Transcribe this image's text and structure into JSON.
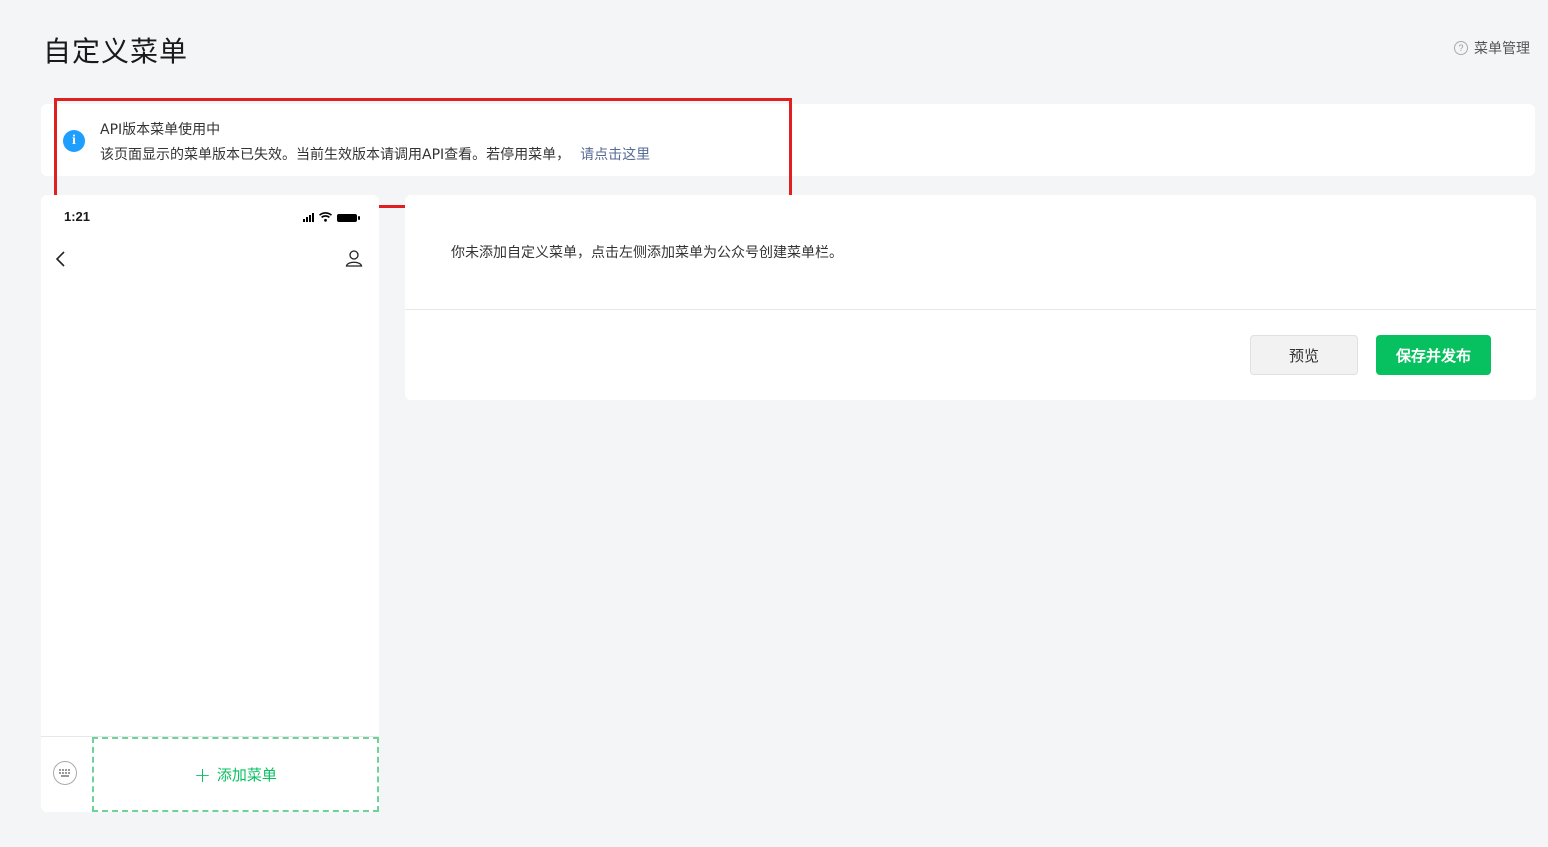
{
  "header": {
    "title": "自定义菜单",
    "help_label": "菜单管理",
    "help_icon": "question-circle-icon"
  },
  "notice": {
    "icon": "info-icon",
    "title": "API版本菜单使用中",
    "body": "该页面显示的菜单版本已失效。当前生效版本请调用API查看。若停用菜单，",
    "link": "请点击这里"
  },
  "phone": {
    "time": "1:21",
    "icons": [
      "signal-icon",
      "wifi-icon",
      "battery-icon",
      "back-icon",
      "user-icon",
      "keyboard-icon"
    ],
    "add_menu_label": "添加菜单"
  },
  "editor": {
    "empty_tip": "你未添加自定义菜单，点击左侧添加菜单为公众号创建菜单栏。",
    "preview_label": "预览",
    "publish_label": "保存并发布"
  },
  "colors": {
    "accent": "#07c160",
    "info": "#1e9fff",
    "link": "#576b95",
    "highlight": "#e02020",
    "background": "#f4f5f7"
  }
}
